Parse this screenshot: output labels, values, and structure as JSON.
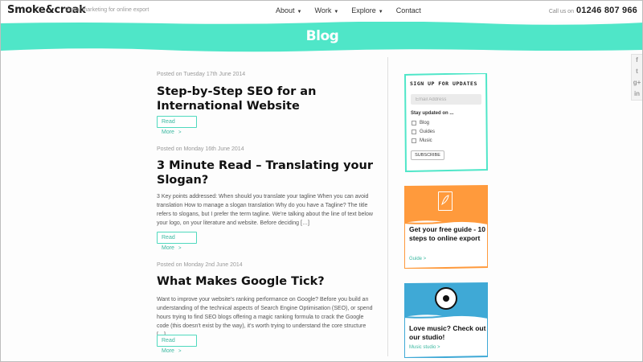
{
  "header": {
    "logo": "Smoke&croak",
    "tagline": "Digital marketing for online export",
    "nav": [
      {
        "label": "About",
        "has_dropdown": true
      },
      {
        "label": "Work",
        "has_dropdown": true
      },
      {
        "label": "Explore",
        "has_dropdown": true
      },
      {
        "label": "Contact",
        "has_dropdown": false
      }
    ],
    "call_us_label": "Call us on",
    "phone": "01246 807 966"
  },
  "banner": {
    "title": "Blog",
    "color": "#4fe6c8"
  },
  "social": {
    "icons": [
      {
        "name": "facebook-icon",
        "glyph": "f"
      },
      {
        "name": "twitter-icon",
        "glyph": "t"
      },
      {
        "name": "googleplus-icon",
        "glyph": "g+"
      },
      {
        "name": "linkedin-icon",
        "glyph": "in"
      }
    ]
  },
  "posts": [
    {
      "meta": "Posted on Tuesday 17th June 2014",
      "title": "Step-by-Step SEO for an International Website",
      "excerpt": "",
      "read_more": "Read More"
    },
    {
      "meta": "Posted on Monday 16th June 2014",
      "title": "3 Minute Read – Translating your Slogan?",
      "excerpt": "3 Key points addressed: When should you translate your tagline When you can avoid translation How to manage a slogan translation Why do you have a Tagline? The title refers to slogans, but I prefer the term tagline. We're talking about the line of text below your logo, on your literature and website. Before deciding […]",
      "read_more": "Read More"
    },
    {
      "meta": "Posted on Monday 2nd June 2014",
      "title": "What Makes Google Tick?",
      "excerpt": "Want to improve your website's ranking performance on Google? Before you build an understanding of the technical aspects of Search Engine Optimisation (SEO), or spend hours trying to find SEO blogs offering a magic ranking formula to crack the Google code (this doesn't exist by the way), it's worth trying to understand the core structure […]",
      "read_more": "Read More"
    }
  ],
  "signup": {
    "title": "SIGN UP FOR UPDATES",
    "email_placeholder": "Email Address",
    "stay_updated": "Stay updated on ...",
    "options": [
      "Blog",
      "Guides",
      "Music"
    ],
    "subscribe": "SUBSCRIBE",
    "border_color": "#4fe6c8"
  },
  "cards": [
    {
      "heading": "Get your free guide - 10 steps to online export",
      "link": "Guide >",
      "color": "#ff9a3c",
      "icon": "document-icon"
    },
    {
      "heading": "Love music? Check out our studio!",
      "link": "Music studio >",
      "color": "#3fa9d6",
      "icon": "vinyl-disc-icon"
    }
  ],
  "colors": {
    "accent": "#4fe6c8",
    "link": "#3ab8a0"
  }
}
